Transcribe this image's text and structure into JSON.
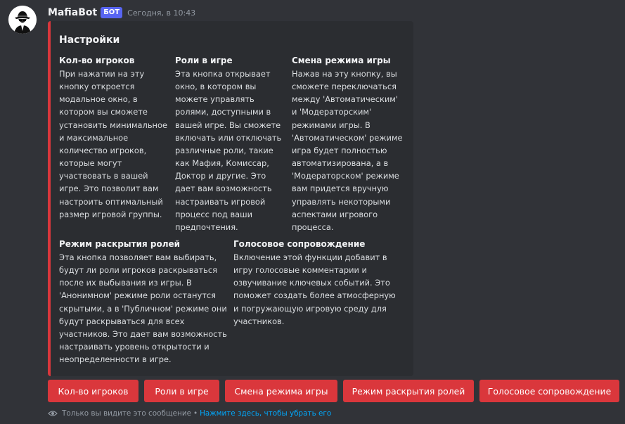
{
  "message": {
    "avatar_icon": "mafia-hat-avatar-icon",
    "username": "MafiaBot",
    "bot_tag": "БОТ",
    "timestamp": "Сегодня, в 10:43"
  },
  "embed": {
    "accent_color": "#da373c",
    "title": "Настройки",
    "fields": [
      {
        "name": "Кол-во игроков",
        "value_lines": [
          "При нажатии на эту",
          "кнопку откроется",
          "модальное окно, в",
          "котором вы сможете",
          "установить минимальное",
          "и максимальное",
          "количество игроков,",
          "которые могут",
          "участвовать в вашей",
          "игре. Это позволит вам",
          "настроить оптимальный",
          "размер игровой группы."
        ]
      },
      {
        "name": "Роли в игре",
        "value_lines": [
          "Эта кнопка открывает",
          "окно, в котором вы",
          "можете управлять",
          "ролями, доступными в",
          "вашей игре. Вы сможете",
          "включать или отключать",
          "различные роли, такие",
          "как Мафия, Комиссар,",
          "Доктор и другие. Это",
          "дает вам возможность",
          "настраивать игровой",
          "процесс под ваши",
          "предпочтения."
        ]
      },
      {
        "name": "Смена режима игры",
        "value_lines": [
          "Нажав на эту кнопку, вы",
          "сможете переключаться",
          "между 'Автоматическим'",
          "и 'Модераторским'",
          "режимами игры. В",
          "'Автоматическом' режиме",
          "игра будет полностью",
          "автоматизирована, а в",
          "'Модераторском' режиме",
          "вам придется вручную",
          "управлять некоторыми",
          "аспектами игрового",
          "процесса."
        ]
      },
      {
        "name": "Режим раскрытия ролей",
        "value_lines": [
          "Эта кнопка позволяет вам выбирать,",
          "будут ли роли игроков раскрываться",
          "после их выбывания из игры. В",
          "'Анонимном' режиме роли останутся",
          "скрытыми, а в 'Публичном' режиме они",
          "будут раскрываться для всех",
          "участников. Это дает вам возможность",
          "настраивать уровень открытости и",
          "неопределенности в игре."
        ]
      },
      {
        "name": "Голосовое сопровождение",
        "value_lines": [
          "Включение этой функции добавит в",
          "игру голосовые комментарии и",
          "озвучивание ключевых событий. Это",
          "поможет создать более атмосферную",
          "и погружающую игровую среду для",
          "участников."
        ]
      }
    ]
  },
  "buttons": [
    {
      "label": "Кол-во игроков"
    },
    {
      "label": "Роли в игре"
    },
    {
      "label": "Смена режима игры"
    },
    {
      "label": "Режим раскрытия ролей"
    },
    {
      "label": "Голосовое сопровождение"
    }
  ],
  "button_color": "#da373c",
  "ephemeral": {
    "icon": "eye-icon",
    "text": "Только вы видите это сообщение",
    "separator": "•",
    "dismiss_link": "Нажмите здесь, чтобы убрать его"
  }
}
